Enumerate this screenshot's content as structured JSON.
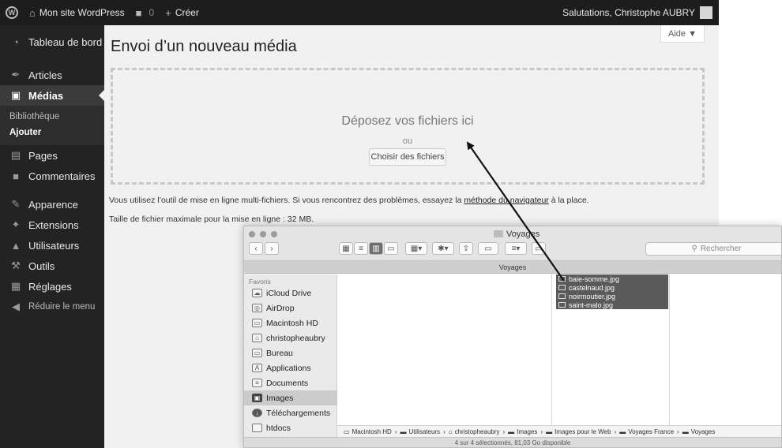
{
  "adminbar": {
    "site_name": "Mon site WordPress",
    "comments_count": "0",
    "new_label": "Créer",
    "greeting": "Salutations, Christophe AUBRY"
  },
  "sidebar": {
    "items": [
      {
        "label": "Tableau de bord",
        "icon": "dashboard-icon",
        "glyph": "◔"
      },
      {
        "label": "Articles",
        "icon": "pushpin-icon",
        "glyph": "✒"
      },
      {
        "label": "Médias",
        "icon": "media-icon",
        "glyph": "▣"
      },
      {
        "label": "Pages",
        "icon": "page-icon",
        "glyph": "▤"
      },
      {
        "label": "Commentaires",
        "icon": "comment-icon",
        "glyph": "■"
      },
      {
        "label": "Apparence",
        "icon": "brush-icon",
        "glyph": "✎"
      },
      {
        "label": "Extensions",
        "icon": "plugin-icon",
        "glyph": "✦"
      },
      {
        "label": "Utilisateurs",
        "icon": "users-icon",
        "glyph": "▲"
      },
      {
        "label": "Outils",
        "icon": "wrench-icon",
        "glyph": "⚒"
      },
      {
        "label": "Réglages",
        "icon": "settings-icon",
        "glyph": "▦"
      }
    ],
    "submenu": [
      "Bibliothèque",
      "Ajouter"
    ],
    "collapse_label": "Réduire le menu"
  },
  "main": {
    "help_label": "Aide ▼",
    "title": "Envoi d’un nouveau média",
    "drop_title": "Déposez vos fichiers ici",
    "drop_or": "ou",
    "choose_button": "Choisir des fichiers",
    "note_prefix": "Vous utilisez l’outil de mise en ligne multi-fichiers. Si vous rencontrez des problèmes, essayez la ",
    "note_link": "méthode du navigateur",
    "note_suffix": " à la place.",
    "max_size": "Taille de fichier maximale pour la mise en ligne : 32 MB."
  },
  "finder": {
    "title": "Voyages",
    "tab": "Voyages",
    "search_placeholder": "Rechercher",
    "favorites_header": "Favoris",
    "favorites": [
      {
        "label": "iCloud Drive",
        "icon": "cloud-icon",
        "glyph": "☁"
      },
      {
        "label": "AirDrop",
        "icon": "airdrop-icon",
        "glyph": "◎"
      },
      {
        "label": "Macintosh HD",
        "icon": "disk-icon",
        "glyph": "▭"
      },
      {
        "label": "christopheaubry",
        "icon": "home-icon",
        "glyph": "⌂"
      },
      {
        "label": "Bureau",
        "icon": "desktop-icon",
        "glyph": "▭"
      },
      {
        "label": "Applications",
        "icon": "applications-icon",
        "glyph": "A"
      },
      {
        "label": "Documents",
        "icon": "documents-icon",
        "glyph": "≡"
      },
      {
        "label": "Images",
        "icon": "pictures-icon",
        "glyph": "▣"
      },
      {
        "label": "Téléchargements",
        "icon": "downloads-icon",
        "glyph": "↓"
      },
      {
        "label": "htdocs",
        "icon": "folder-icon",
        "glyph": ""
      }
    ],
    "files": [
      "baie-somme.jpg",
      "castelnaud.jpg",
      "noirmoutier.jpg",
      "saint-malo.jpg"
    ],
    "path": [
      "Macintosh HD",
      "Utilisateurs",
      "christopheaubry",
      "Images",
      "Images pour le Web",
      "Voyages France",
      "Voyages"
    ],
    "status": "4 sur 4 sélectionnés, 81,03 Go disponible"
  }
}
